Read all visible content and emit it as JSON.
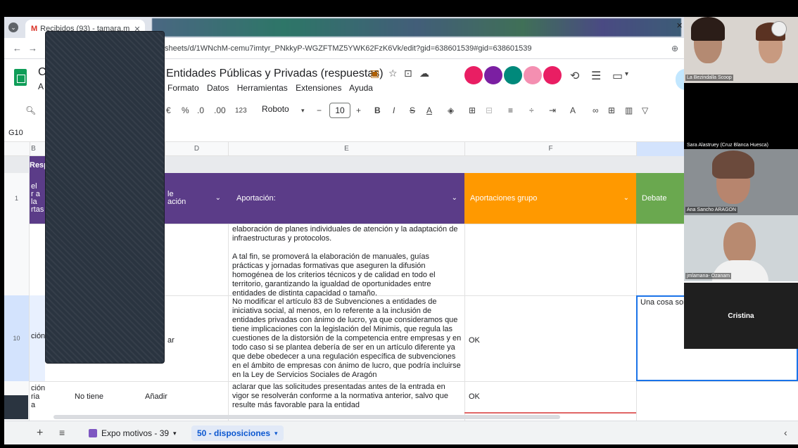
{
  "browser": {
    "tab_active_label": "Recibidos (93) - tamara.m",
    "url": "sheets/d/1WNchM-cemu7imtyr_PNkkyP-WGZFTMZ5YWK62FzK6Vk/edit?gid=638601539#gid=638601539"
  },
  "sheet": {
    "title": "Entidades Públicas y Privadas (respuestas)",
    "title_prefix_line1": "C",
    "title_prefix_line2": "A",
    "menus": [
      "Formato",
      "Datos",
      "Herramientas",
      "Extensiones",
      "Ayuda"
    ],
    "font": "Roboto",
    "font_size": "10",
    "toolbar_zoom": "123",
    "cell_ref": "G10"
  },
  "columns": {
    "b": "B",
    "d": "D",
    "e": "E",
    "f": "F"
  },
  "group_label": "Resp",
  "header_row": {
    "num": "1",
    "b_partial": [
      "el",
      "r a la",
      "rtas"
    ],
    "d_partial": [
      "le",
      "ación"
    ],
    "aportacion": "Aportación:",
    "aportaciones_grupo": "Aportaciones grupo",
    "debate": "Debate"
  },
  "rows": {
    "row9_text": "elaboración de planes individuales de atención y la adaptación de infraestructuras y protocolos.",
    "row9_text2": "A tal fin, se promoverá la elaboración de manuales, guías prácticas y jornadas formativas que aseguren la difusión homogénea de los criterios técnicos y de calidad en todo el territorio, garantizando la igualdad de oportunidades entre entidades de distinta capacidad o tamaño.",
    "row10_num": "10",
    "row10_b": "ción",
    "row10_d": "ar",
    "row10_text": "No modificar el artículo 83 de Subvenciones a entidades de iniciativa social, al menos, en lo referente a la inclusión de entidades privadas con ánimo de lucro, ya que consideramos que tiene implicaciones con la legislación del Minimis, que regula las cuestiones de la distorsión de la competencia entre empresas y en todo caso si se plantea debería de ser en un artículo diferente ya que debe obedecer a una regulación específica de subvenciones en el ámbito de empresas con ánimo de lucro, que podría incluirse en la Ley de Servicios Sociales de Aragón",
    "row10_f": "OK",
    "row10_g": "Una cosa son",
    "row11_num": "11",
    "row11_b": [
      "ción",
      "ria",
      "a"
    ],
    "row11_c": "No tiene",
    "row11_d": "Añadir",
    "row11_text": "aclarar que las solicitudes presentadas antes de la entrada en vigor se resolverán conforme a la normativa anterior, salvo que resulte más favorable para la entidad",
    "row11_f": "OK"
  },
  "sheet_tabs": {
    "tab1": "Expo motivos - 39",
    "tab2": "50 - disposiciones"
  },
  "participants": [
    "La Bezindalla Scoop",
    "Sara Alastruey (Cruz Blanca Huesca)",
    "Ana Sancho ARAGON",
    "jmlamana-  Ozanam",
    "Cristina"
  ]
}
